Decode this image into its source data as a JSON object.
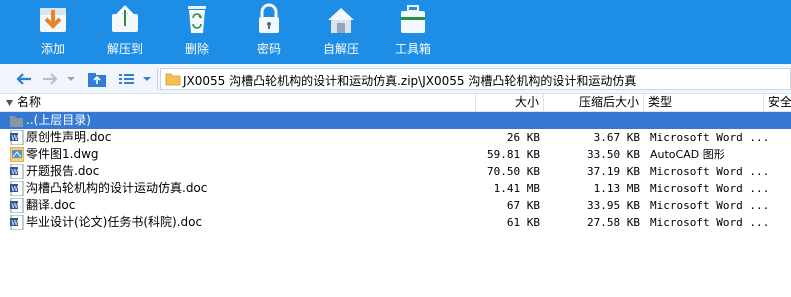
{
  "toolbar": {
    "items": [
      {
        "label": "添加",
        "icon": "add-archive-icon"
      },
      {
        "label": "解压到",
        "icon": "extract-to-icon"
      },
      {
        "label": "删除",
        "icon": "delete-icon"
      },
      {
        "label": "密码",
        "icon": "password-lock-icon"
      },
      {
        "label": "自解压",
        "icon": "self-extract-icon"
      },
      {
        "label": "工具箱",
        "icon": "toolbox-icon"
      }
    ]
  },
  "address": {
    "path": "JX0055 沟槽凸轮机构的设计和运动仿真.zip\\JX0055 沟槽凸轮机构的设计和运动仿真"
  },
  "columns": {
    "name": "名称",
    "size": "大小",
    "packed": "压缩后大小",
    "type": "类型",
    "security": "安全"
  },
  "up_row": {
    "label": "..(上层目录)"
  },
  "files": [
    {
      "name": "原创性声明.doc",
      "size": "26 KB",
      "packed": "3.67 KB",
      "type": "Microsoft Word ...",
      "icon": "word-doc-icon"
    },
    {
      "name": "零件图1.dwg",
      "size": "59.81 KB",
      "packed": "33.50 KB",
      "type": "AutoCAD 图形",
      "icon": "dwg-file-icon"
    },
    {
      "name": "开题报告.doc",
      "size": "70.50 KB",
      "packed": "37.19 KB",
      "type": "Microsoft Word ...",
      "icon": "word-doc-icon"
    },
    {
      "name": "沟槽凸轮机构的设计运动仿真.doc",
      "size": "1.41 MB",
      "packed": "1.13 MB",
      "type": "Microsoft Word ...",
      "icon": "word-doc-icon"
    },
    {
      "name": "翻译.doc",
      "size": "67 KB",
      "packed": "33.95 KB",
      "type": "Microsoft Word ...",
      "icon": "word-doc-icon"
    },
    {
      "name": "毕业设计(论文)任务书(科院).doc",
      "size": "61 KB",
      "packed": "27.58 KB",
      "type": "Microsoft Word ...",
      "icon": "word-doc-icon"
    }
  ],
  "colors": {
    "toolbar_bg": "#1e8de6",
    "selection_bg": "#3579d3",
    "nav_icon": "#2f7fd8"
  }
}
